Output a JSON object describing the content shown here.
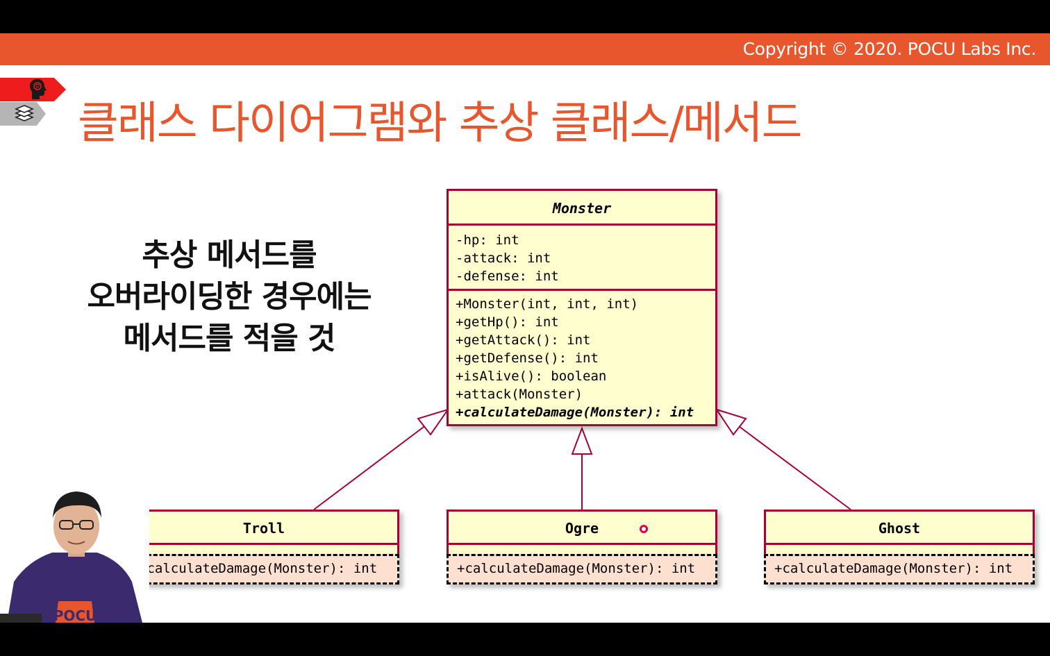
{
  "header": {
    "copyright": "Copyright © 2020. POCU Labs Inc."
  },
  "slide": {
    "title": "클래스 다이어그램와 추상 클래스/메서드",
    "note_lines": [
      "추상 메서드를",
      "오버라이딩한 경우에는",
      "메서드를 적을 것"
    ]
  },
  "uml": {
    "monster": {
      "name": "Monster",
      "attributes": [
        "-hp: int",
        "-attack: int",
        "-defense: int"
      ],
      "methods": [
        "+Monster(int, int, int)",
        "+getHp(): int",
        "+getAttack(): int",
        "+getDefense(): int",
        "+isAlive(): boolean",
        "+attack(Monster)"
      ],
      "abstract_method": "+calculateDamage(Monster): int"
    },
    "troll": {
      "name": "Troll",
      "method": "+calculateDamage(Monster): int"
    },
    "ogre": {
      "name": "Ogre",
      "method": "+calculateDamage(Monster): int"
    },
    "ghost": {
      "name": "Ghost",
      "method": "+calculateDamage(Monster): int"
    },
    "colors": {
      "fill": "#fefece",
      "border": "#a80036",
      "override_fill": "#fde0cf",
      "accent": "#e8562d"
    }
  },
  "presenter": {
    "shirt_text": "POCU"
  },
  "icons": [
    "brain-head-icon",
    "books-icon"
  ]
}
